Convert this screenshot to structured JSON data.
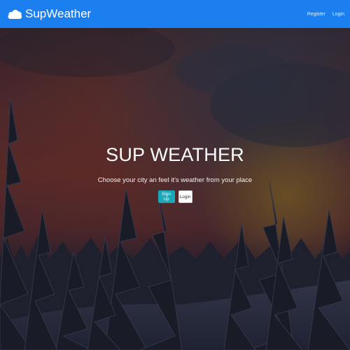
{
  "navbar": {
    "brand_name": "SupWeather",
    "brand_icon": "cloud-icon",
    "links": {
      "register": "Register",
      "login": "Login"
    },
    "color": "#1b7ff0"
  },
  "hero": {
    "title": "SUP WEATHER",
    "subtitle": "Choose your city an feel it's weather from your place",
    "buttons": {
      "signup": "Sign Up",
      "login": "Login"
    },
    "background": "snowy forest at dusk under a red cloudy sky"
  },
  "colors": {
    "signup_button": "#1aa8b8",
    "login_button": "#ffffff"
  }
}
